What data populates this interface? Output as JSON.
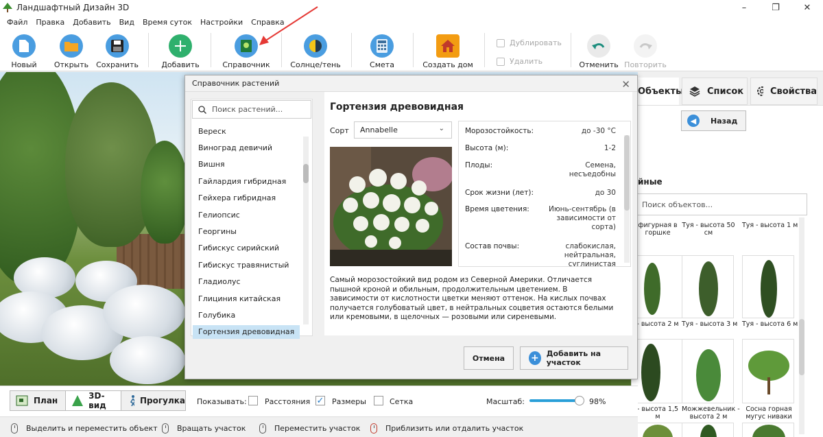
{
  "app": {
    "title": "Ландшафтный Дизайн 3D"
  },
  "window_controls": {
    "minimize": "–",
    "maximize": "❐",
    "close": "✕"
  },
  "menu": [
    "Файл",
    "Правка",
    "Добавить",
    "Вид",
    "Время суток",
    "Настройки",
    "Справка"
  ],
  "toolbar": {
    "new": "Новый",
    "open": "Открыть",
    "save": "Сохранить",
    "add": "Добавить",
    "reference": "Справочник",
    "sun": "Солнце/тень",
    "estimate": "Смета",
    "house": "Создать дом",
    "duplicate": "Дублировать",
    "delete": "Удалить",
    "undo": "Отменить",
    "redo": "Повторить"
  },
  "dialog": {
    "title": "Справочник растений",
    "search_placeholder": "Поиск растений...",
    "plants": [
      "Вереск",
      "Виноград девичий",
      "Вишня",
      "Гайлардия гибридная",
      "Гейхера гибридная",
      "Гелиопсис",
      "Георгины",
      "Гибискус сирийский",
      "Гибискус травянистый",
      "Гладиолус",
      "Глициния китайская",
      "Голубика",
      "Гортензия древовидная"
    ],
    "selected_index": 12,
    "plant_title": "Гортензия древовидная",
    "sort_label": "Сорт",
    "sort_value": "Annabelle",
    "properties": [
      {
        "k": "Морозостойкость:",
        "v": "до -30 °C"
      },
      {
        "k": "Высота (м):",
        "v": "1-2"
      },
      {
        "k": "Плоды:",
        "v": "Семена,\nнесъедобны"
      },
      {
        "k": "Срок жизни (лет):",
        "v": "до 30"
      },
      {
        "k": "Время цветения:",
        "v": "Июнь-сентябрь (в\nзависимости от\nсорта)"
      },
      {
        "k": "Состав почвы:",
        "v": "слабокислая,\nнейтральная,\nсуглинистая"
      }
    ],
    "description": "Самый морозостойкий вид родом из Северной Америки. Отличается пышной кроной и обильным, продолжительным цветением. В зависимости от кислотности цветки меняют оттенок. На кислых почвах получается голубоватый цвет, в нейтральных соцветия остаются белыми или кремовыми, в щелочных — розовыми или сиреневыми.",
    "cancel": "Отмена",
    "add": "Добавить на участок"
  },
  "right_panel": {
    "tabs": [
      "Объекты",
      "Список",
      "Свойства"
    ],
    "back": "Назад",
    "section": "йные",
    "search_placeholder": "Поиск объектов...",
    "top_captions": [
      "фигурная в\nгоршке",
      "Туя - высота 50\nсм",
      "Туя - высота 1 м"
    ],
    "items": [
      {
        "cap": "- высота 2 м"
      },
      {
        "cap": "Туя - высота 3 м"
      },
      {
        "cap": "Туя - высота 6 м"
      },
      {
        "cap": "- высота 1,5\nм"
      },
      {
        "cap": "Можжевельник -\nвысота 2 м"
      },
      {
        "cap": "Сосна горная\nмугус ниваки"
      }
    ]
  },
  "bottombar": {
    "views": [
      "План",
      "3D-вид",
      "Прогулка"
    ],
    "show_label": "Показывать:",
    "distances": "Расстояния",
    "sizes": "Размеры",
    "grid": "Сетка",
    "checks": {
      "distances": false,
      "sizes": true,
      "grid": false
    },
    "scale_label": "Масштаб:",
    "scale_value": "98%",
    "scale_fraction": 0.98
  },
  "statusbar": [
    "Выделить и переместить объект",
    "Вращать участок",
    "Переместить участок",
    "Приблизить или отдалить участок"
  ],
  "colors": {
    "accent": "#2a9fd8",
    "new": "#4a9de0",
    "open": "#f5a623",
    "save": "#3d8fd6",
    "add": "#2fb06d",
    "reference": "#4a9de0",
    "sun": "#4a9de0",
    "estimate": "#4a9de0",
    "house": "#f39c12",
    "undo": "#e8e8e8",
    "arrow": "#e53935"
  }
}
